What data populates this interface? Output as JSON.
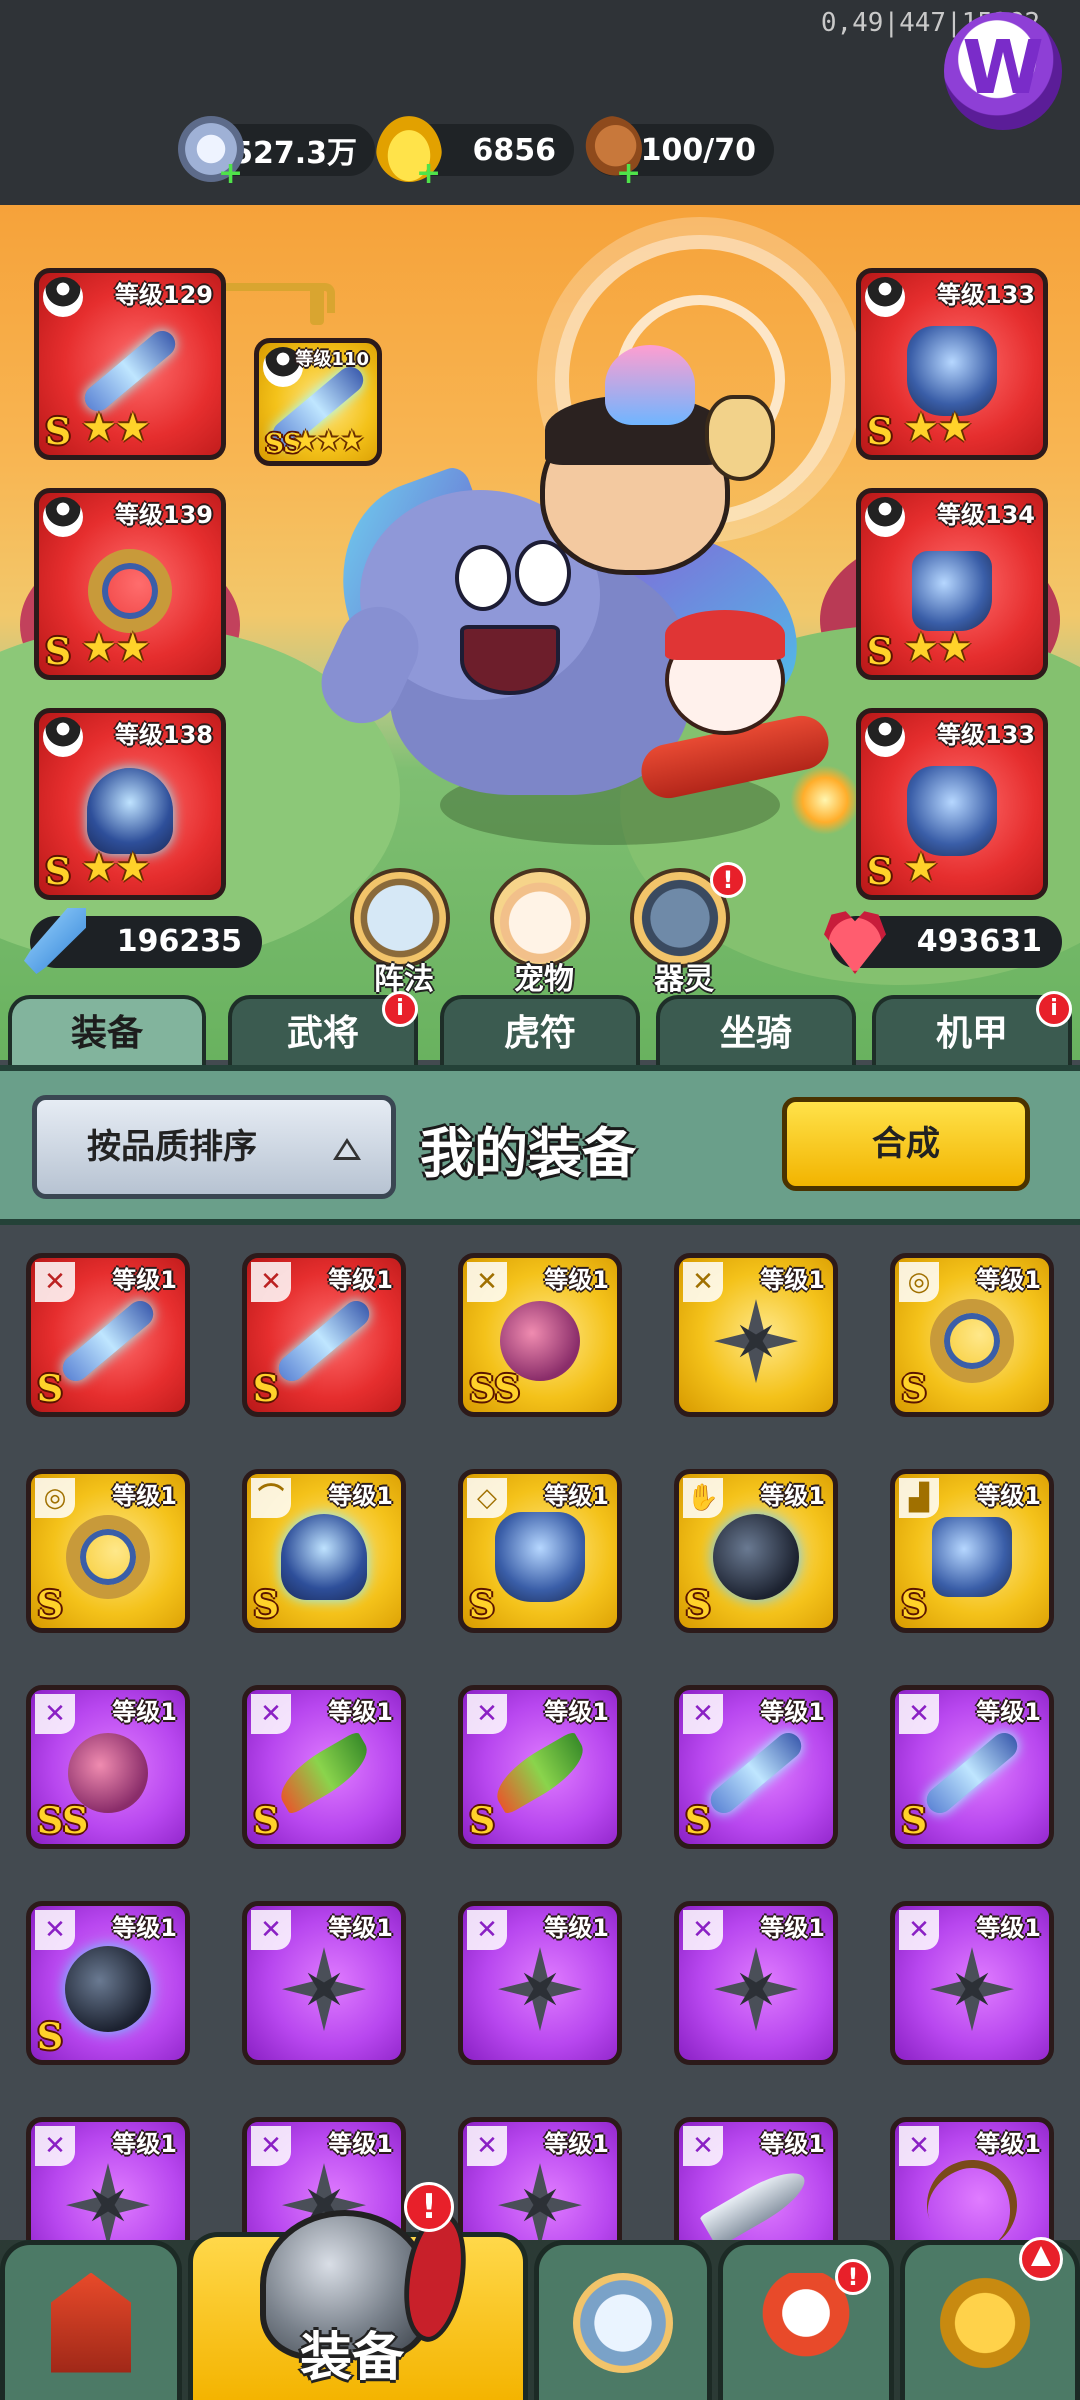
{
  "debug_overlay": "0,49|447|15382",
  "resources": {
    "silver": {
      "value": "3527.3万",
      "icon": "silver-coin-icon"
    },
    "gold": {
      "value": "6856",
      "icon": "gold-ingot-icon"
    },
    "stamina": {
      "value": "100/70",
      "icon": "meat-drumstick-icon"
    }
  },
  "hero_slots": {
    "left": [
      {
        "level": "等级129",
        "grade": "S",
        "stars": 2,
        "rarity": "red",
        "art": "weapon"
      },
      {
        "level": "等级139",
        "grade": "S",
        "stars": 2,
        "rarity": "red",
        "art": "ring"
      },
      {
        "level": "等级138",
        "grade": "S",
        "stars": 2,
        "rarity": "red",
        "art": "helm"
      }
    ],
    "right": [
      {
        "level": "等级133",
        "grade": "S",
        "stars": 2,
        "rarity": "red",
        "art": "armor"
      },
      {
        "level": "等级134",
        "grade": "S",
        "stars": 2,
        "rarity": "red",
        "art": "boots"
      },
      {
        "level": "等级133",
        "grade": "S",
        "stars": 1,
        "rarity": "red",
        "art": "armor"
      }
    ],
    "linked": {
      "level": "等级110",
      "grade": "SS",
      "stars": 3,
      "rarity": "gold",
      "art": "weapon"
    }
  },
  "stats": {
    "power": "196235",
    "hp": "493631"
  },
  "circle_buttons": [
    {
      "label": "阵法",
      "badge": ""
    },
    {
      "label": "宠物",
      "badge": ""
    },
    {
      "label": "器灵",
      "badge": "!"
    }
  ],
  "tabs": [
    {
      "label": "装备",
      "active": true,
      "badge": ""
    },
    {
      "label": "武将",
      "active": false,
      "badge": "i"
    },
    {
      "label": "虎符",
      "active": false,
      "badge": ""
    },
    {
      "label": "坐骑",
      "active": false,
      "badge": ""
    },
    {
      "label": "机甲",
      "active": false,
      "badge": "i"
    }
  ],
  "inventory_header": {
    "sort_label": "按品质排序",
    "title": "我的装备",
    "synthesize_label": "合成"
  },
  "inventory": [
    {
      "level": "等级1",
      "rarity": "red",
      "grade": "S",
      "art": "weapon",
      "type": "sword"
    },
    {
      "level": "等级1",
      "rarity": "red",
      "grade": "S",
      "art": "weapon",
      "type": "sword"
    },
    {
      "level": "等级1",
      "rarity": "gold",
      "grade": "SS",
      "art": "monster",
      "type": "sword"
    },
    {
      "level": "等级1",
      "rarity": "gold",
      "grade": "",
      "art": "shuriken",
      "type": "sword"
    },
    {
      "level": "等级1",
      "rarity": "gold",
      "grade": "S",
      "art": "ring",
      "type": "medal"
    },
    {
      "level": "等级1",
      "rarity": "gold",
      "grade": "S",
      "art": "ring",
      "type": "medal"
    },
    {
      "level": "等级1",
      "rarity": "gold",
      "grade": "S",
      "art": "helm",
      "type": "helmet"
    },
    {
      "level": "等级1",
      "rarity": "gold",
      "grade": "S",
      "art": "armor",
      "type": "armor"
    },
    {
      "level": "等级1",
      "rarity": "gold",
      "grade": "S",
      "art": "bomb",
      "type": "glove"
    },
    {
      "level": "等级1",
      "rarity": "gold",
      "grade": "S",
      "art": "boots",
      "type": "boot"
    },
    {
      "level": "等级1",
      "rarity": "purple",
      "grade": "SS",
      "art": "monster",
      "type": "sword"
    },
    {
      "level": "等级1",
      "rarity": "purple",
      "grade": "S",
      "art": "blade",
      "type": "sword"
    },
    {
      "level": "等级1",
      "rarity": "purple",
      "grade": "S",
      "art": "blade",
      "type": "sword"
    },
    {
      "level": "等级1",
      "rarity": "purple",
      "grade": "S",
      "art": "weapon",
      "type": "sword"
    },
    {
      "level": "等级1",
      "rarity": "purple",
      "grade": "S",
      "art": "weapon",
      "type": "sword"
    },
    {
      "level": "等级1",
      "rarity": "purple",
      "grade": "S",
      "art": "bomb",
      "type": "sword"
    },
    {
      "level": "等级1",
      "rarity": "purple",
      "grade": "",
      "art": "shuriken",
      "type": "sword"
    },
    {
      "level": "等级1",
      "rarity": "purple",
      "grade": "",
      "art": "shuriken",
      "type": "sword"
    },
    {
      "level": "等级1",
      "rarity": "purple",
      "grade": "",
      "art": "shuriken",
      "type": "sword"
    },
    {
      "level": "等级1",
      "rarity": "purple",
      "grade": "",
      "art": "shuriken",
      "type": "sword"
    },
    {
      "level": "等级1",
      "rarity": "purple",
      "grade": "",
      "art": "shuriken",
      "type": "sword"
    },
    {
      "level": "等级1",
      "rarity": "purple",
      "grade": "",
      "art": "shuriken",
      "type": "sword"
    },
    {
      "level": "等级1",
      "rarity": "purple",
      "grade": "",
      "art": "shuriken",
      "type": "sword"
    },
    {
      "level": "等级1",
      "rarity": "purple",
      "grade": "",
      "art": "scimitar",
      "type": "sword"
    },
    {
      "level": "等级1",
      "rarity": "purple",
      "grade": "",
      "art": "bow",
      "type": "sword"
    }
  ],
  "bottom_nav": [
    {
      "label": "",
      "icon": "city-gate-icon",
      "active": false,
      "badge": ""
    },
    {
      "label": "装备",
      "icon": "helmet-icon",
      "active": true,
      "badge": "!"
    },
    {
      "label": "",
      "icon": "battle-shield-icon",
      "active": false,
      "badge": ""
    },
    {
      "label": "",
      "icon": "hero-icon",
      "active": false,
      "badge": "!"
    },
    {
      "label": "",
      "icon": "upgrade-fist-icon",
      "active": false,
      "badge": "up"
    }
  ],
  "colors": {
    "rarity_red": "#e62e2e",
    "rarity_gold": "#f4c21a",
    "rarity_purple": "#b847ef",
    "tab_active": "#82b49d",
    "synth_button": "#f4c21a"
  }
}
